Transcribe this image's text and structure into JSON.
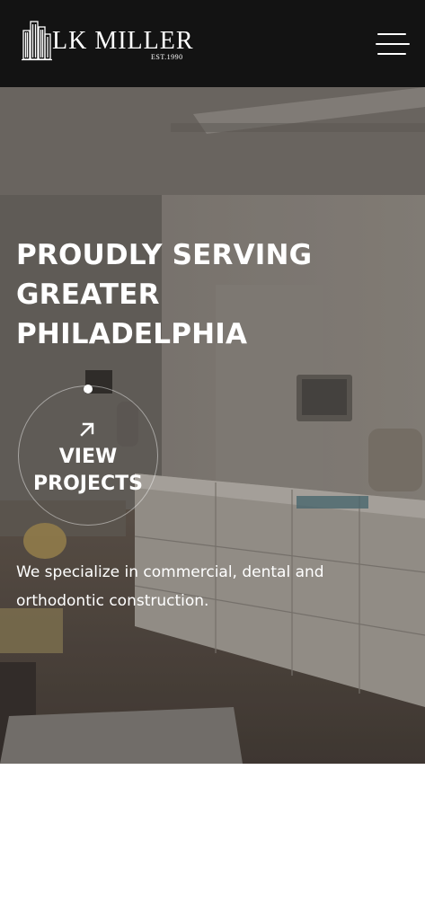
{
  "header": {
    "logo_name": "LK MILLER",
    "logo_est": "EST.1990",
    "logo_icon": "building-icon",
    "menu_icon": "hamburger-menu-icon"
  },
  "hero": {
    "title_lines": [
      "PROUDLY SERVING",
      "GREATER",
      "PHILADELPHIA"
    ],
    "cta": {
      "icon": "arrow-up-right-icon",
      "label_lines": [
        "VIEW",
        "PROJECTS"
      ]
    },
    "description_lines": [
      "We specialize in commercial, dental and",
      "orthodontic construction."
    ]
  },
  "colors": {
    "header_bg": "#131313",
    "text": "#ffffff",
    "page_bg": "#ffffff"
  }
}
